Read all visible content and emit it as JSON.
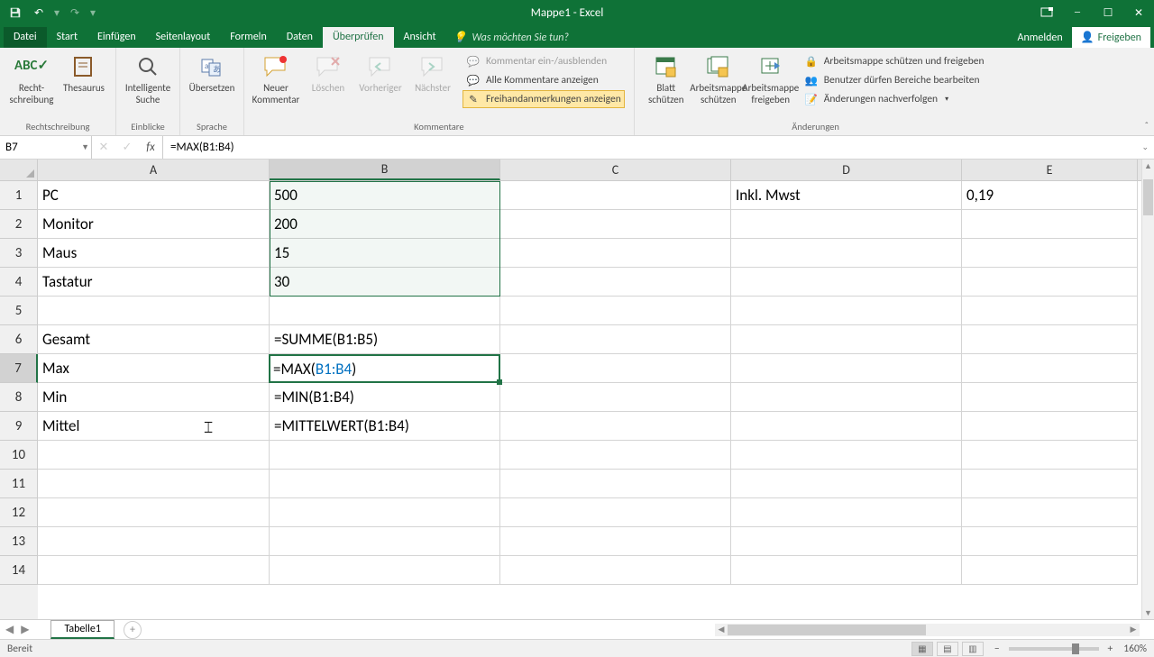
{
  "title": "Mappe1 - Excel",
  "qat": {
    "save": "💾",
    "undo": "↶",
    "redo": "↷"
  },
  "tabs": {
    "file": "Datei",
    "items": [
      "Start",
      "Einfügen",
      "Seitenlayout",
      "Formeln",
      "Daten",
      "Überprüfen",
      "Ansicht"
    ],
    "active": "Überprüfen",
    "tellme": "Was möchten Sie tun?",
    "signin": "Anmelden",
    "share": "Freigeben"
  },
  "ribbon": {
    "proofing": {
      "btn1": "Recht-\nschreibung",
      "btn2": "Thesaurus",
      "label": "Rechtschreibung"
    },
    "insights": {
      "btn": "Intelligente\nSuche",
      "label": "Einblicke"
    },
    "language": {
      "btn": "Übersetzen",
      "label": "Sprache"
    },
    "comments": {
      "new": "Neuer\nKommentar",
      "del": "Löschen",
      "prev": "Vorheriger",
      "next": "Nächster",
      "toggle": "Kommentar ein-/ausblenden",
      "showall": "Alle Kommentare anzeigen",
      "ink": "Freihandanmerkungen anzeigen",
      "label": "Kommentare"
    },
    "protect": {
      "sheet": "Blatt\nschützen",
      "wb": "Arbeitsmappe\nschützen",
      "share": "Arbeitsmappe\nfreigeben",
      "protshare": "Arbeitsmappe schützen und freigeben",
      "ranges": "Benutzer dürfen Bereiche bearbeiten",
      "track": "Änderungen nachverfolgen",
      "label": "Änderungen"
    }
  },
  "namebox": "B7",
  "formula": "=MAX(B1:B4)",
  "columns": [
    "A",
    "B",
    "C",
    "D",
    "E"
  ],
  "rows": [
    "1",
    "2",
    "3",
    "4",
    "5",
    "6",
    "7",
    "8",
    "9",
    "10",
    "11",
    "12",
    "13",
    "14"
  ],
  "cells": {
    "A1": "PC",
    "B1": "500",
    "A2": "Monitor",
    "B2": "200",
    "A3": "Maus",
    "B3": "15",
    "A4": "Tastatur",
    "B4": "30",
    "D1": "Inkl. Mwst",
    "E1": "0,19",
    "A6": "Gesamt",
    "B6": "=SUMME(B1:B5)",
    "A7": "Max",
    "B7": "=MAX(B1:B4)",
    "A8": "Min",
    "B8": "=MIN(B1:B4)",
    "A9": "Mittel",
    "B9": "=MITTELWERT(B1:B4)"
  },
  "sheet": {
    "name": "Tabelle1"
  },
  "status": {
    "ready": "Bereit",
    "zoom": "160%"
  }
}
